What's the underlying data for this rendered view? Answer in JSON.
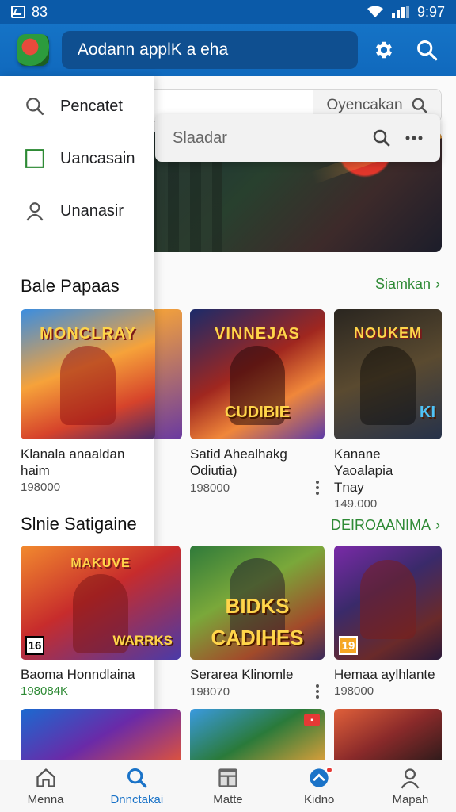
{
  "status_bar": {
    "left_text": "83",
    "time": "9:97"
  },
  "app_bar": {
    "title": "Aodann applK a eha"
  },
  "search": {
    "button_label": "Oyencakan"
  },
  "overlay_search": {
    "placeholder": "Slaadar"
  },
  "drawer": {
    "items": [
      {
        "label": "Pencatet",
        "icon": "search-icon"
      },
      {
        "label": "Uancasain",
        "icon": "square-icon"
      },
      {
        "label": "Unanasir",
        "icon": "person-icon"
      }
    ]
  },
  "section1": {
    "title": "Bale Papaas",
    "link": "Siamkan",
    "cards": [
      {
        "art_title": "MONCLRAY",
        "name_line1": "Klanala anaaldan",
        "name_line2": "haim",
        "meta": "198000"
      },
      {
        "art_title": "VINNEJAS",
        "art_sub": "CUDIBIE",
        "name_line1": "Satid Ahealhakg",
        "name_line2": "Odiutia)",
        "meta": "198000"
      },
      {
        "art_title": "NOUKEM",
        "art_sub": "KI",
        "name_line1": "Kanane Yaoalapia",
        "name_line2": "Tnay",
        "meta": "149.000"
      }
    ]
  },
  "section2": {
    "title": "Slnie Satigaine",
    "link": "DEIROAANIMA",
    "cards": [
      {
        "art_title": "MAKUVE",
        "art_sub": "WARRKS",
        "age": "16",
        "name_line1": "Baoma Honndlaina",
        "meta": "198084K"
      },
      {
        "art_title": "BIDKS",
        "art_sub": "CADIHES",
        "name_line1": "Serarea Klinomle",
        "meta": "198070"
      },
      {
        "age": "19",
        "name_line1": "Hemaa aylhlante",
        "meta": "198000"
      }
    ]
  },
  "bottom_nav": {
    "items": [
      {
        "label": "Menna",
        "icon": "home-icon"
      },
      {
        "label": "Dnnctakai",
        "icon": "search-icon"
      },
      {
        "label": "Matte",
        "icon": "grid-icon"
      },
      {
        "label": "Kidno",
        "icon": "badge-icon"
      },
      {
        "label": "Mapah",
        "icon": "person-icon"
      }
    ]
  },
  "colors": {
    "primary": "#1573c6",
    "accent_green": "#2e8a35",
    "active_nav": "#1a73c8"
  }
}
